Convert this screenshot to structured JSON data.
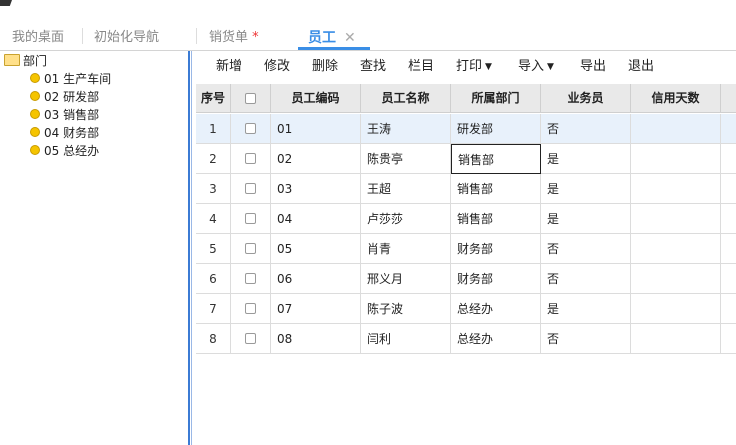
{
  "tabs": [
    {
      "label": "我的桌面"
    },
    {
      "label": "初始化导航"
    },
    {
      "label": "销货单",
      "modified": "*"
    },
    {
      "label": "员工",
      "close": "✕"
    }
  ],
  "toolbar": {
    "add": "新增",
    "edit": "修改",
    "delete": "删除",
    "search": "查找",
    "columns": "栏目",
    "print": "打印",
    "import": "导入",
    "export": "导出",
    "exit": "退出"
  },
  "tree": {
    "root": "部门",
    "items": [
      {
        "label": "01 生产车间"
      },
      {
        "label": "02 研发部"
      },
      {
        "label": "03 销售部"
      },
      {
        "label": "04 财务部"
      },
      {
        "label": "05 总经办"
      }
    ]
  },
  "grid": {
    "headers": {
      "index": "序号",
      "code": "员工编码",
      "name": "员工名称",
      "dept": "所属部门",
      "salesman": "业务员",
      "credit_days": "信用天数"
    },
    "rows": [
      {
        "index": "1",
        "code": "01",
        "name": "王涛",
        "dept": "研发部",
        "salesman": "否"
      },
      {
        "index": "2",
        "code": "02",
        "name": "陈贵亭",
        "dept": "销售部",
        "salesman": "是"
      },
      {
        "index": "3",
        "code": "03",
        "name": "王超",
        "dept": "销售部",
        "salesman": "是"
      },
      {
        "index": "4",
        "code": "04",
        "name": "卢莎莎",
        "dept": "销售部",
        "salesman": "是"
      },
      {
        "index": "5",
        "code": "05",
        "name": "肖青",
        "dept": "财务部",
        "salesman": "否"
      },
      {
        "index": "6",
        "code": "06",
        "name": "邢义月",
        "dept": "财务部",
        "salesman": "否"
      },
      {
        "index": "7",
        "code": "07",
        "name": "陈子波",
        "dept": "总经办",
        "salesman": "是"
      },
      {
        "index": "8",
        "code": "08",
        "name": "闫利",
        "dept": "总经办",
        "salesman": "否"
      }
    ]
  },
  "colors": {
    "accent": "#3a8ee6",
    "selected_row": "#e8f1fb",
    "header_bg": "#e9e9e9",
    "divider": "#3b7bd4"
  }
}
